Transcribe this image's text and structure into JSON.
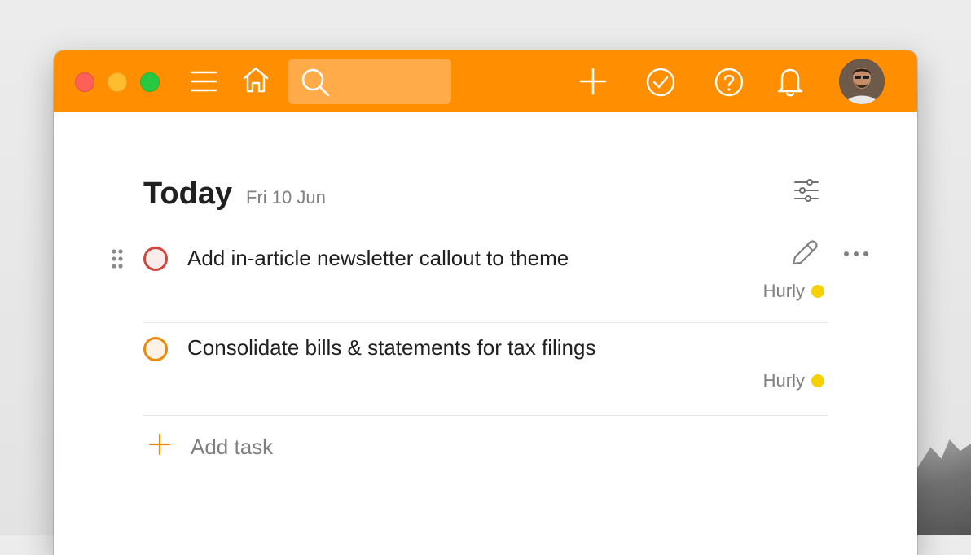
{
  "window": {
    "traffic_lights": [
      "close",
      "minimize",
      "maximize"
    ]
  },
  "toolbar": {
    "color": "#ff8f00",
    "search": {
      "placeholder": "",
      "value": ""
    },
    "icons": [
      "menu-icon",
      "home-icon",
      "search-icon",
      "plus-icon",
      "check-circle-icon",
      "help-icon",
      "bell-icon",
      "avatar"
    ]
  },
  "view": {
    "title": "Today",
    "date": "Fri 10 Jun"
  },
  "tasks": [
    {
      "text": "Add in-article newsletter callout to theme",
      "project": "Hurly",
      "priority_color": "#d1453b",
      "project_color": "#f7d000"
    },
    {
      "text": "Consolidate bills & statements for tax filings",
      "project": "Hurly",
      "priority_color": "#eb8909",
      "project_color": "#f7d000"
    }
  ],
  "add_task": {
    "label": "Add task"
  }
}
